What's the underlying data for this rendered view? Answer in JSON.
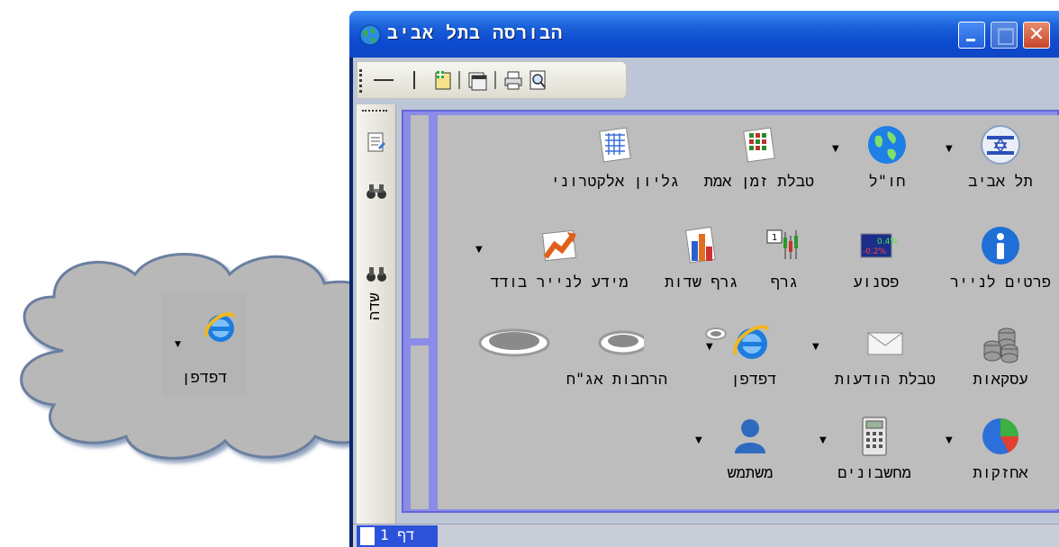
{
  "window": {
    "title": "הבורסה בתל אביב",
    "controls": {
      "close_glyph": "✕"
    }
  },
  "sidebar": {
    "label": "שדה"
  },
  "status": {
    "page_label": "דף 1"
  },
  "callout": {
    "label": "דפדפן",
    "icon": "internet-explorer-icon"
  },
  "grid": {
    "items": [
      {
        "label": "תל אביב",
        "icon": "israel-flag-icon",
        "has_dropdown": true
      },
      {
        "label": "חו\"ל",
        "icon": "globe-icon",
        "has_dropdown": true
      },
      {
        "label": "טבלת זמן אמת",
        "icon": "realtime-table-icon",
        "has_dropdown": false
      },
      {
        "label": "גליון אלקטרוני",
        "icon": "spreadsheet-icon",
        "has_dropdown": false
      },
      {
        "label": "פרטים לנייר",
        "icon": "info-icon",
        "has_dropdown": false
      },
      {
        "label": "פסנוע",
        "icon": "ticker-icon",
        "has_dropdown": false
      },
      {
        "label": "גרף",
        "icon": "candlestick-chart-icon",
        "has_dropdown": false
      },
      {
        "label": "גרף שדות",
        "icon": "bar-chart-icon",
        "has_dropdown": false
      },
      {
        "label": "מידע לנייר בודד",
        "icon": "trend-arrow-icon",
        "has_dropdown": true
      },
      {
        "label": "עסקאות",
        "icon": "coins-icon",
        "has_dropdown": false
      },
      {
        "label": "טבלת הודעות",
        "icon": "envelope-icon",
        "has_dropdown": true
      },
      {
        "label": "דפדפן",
        "icon": "internet-explorer-icon",
        "has_dropdown": true
      },
      {
        "label": "הרחבות אג\"ח",
        "icon": "ring-icon",
        "has_dropdown": false
      },
      {
        "label": "",
        "icon": "ring-icon",
        "has_dropdown": true
      },
      {
        "label": "אחזקות",
        "icon": "pie-chart-icon",
        "has_dropdown": true
      },
      {
        "label": "מחשבונים",
        "icon": "calculator-icon",
        "has_dropdown": true
      },
      {
        "label": "משתמש",
        "icon": "user-icon",
        "has_dropdown": true
      }
    ]
  }
}
